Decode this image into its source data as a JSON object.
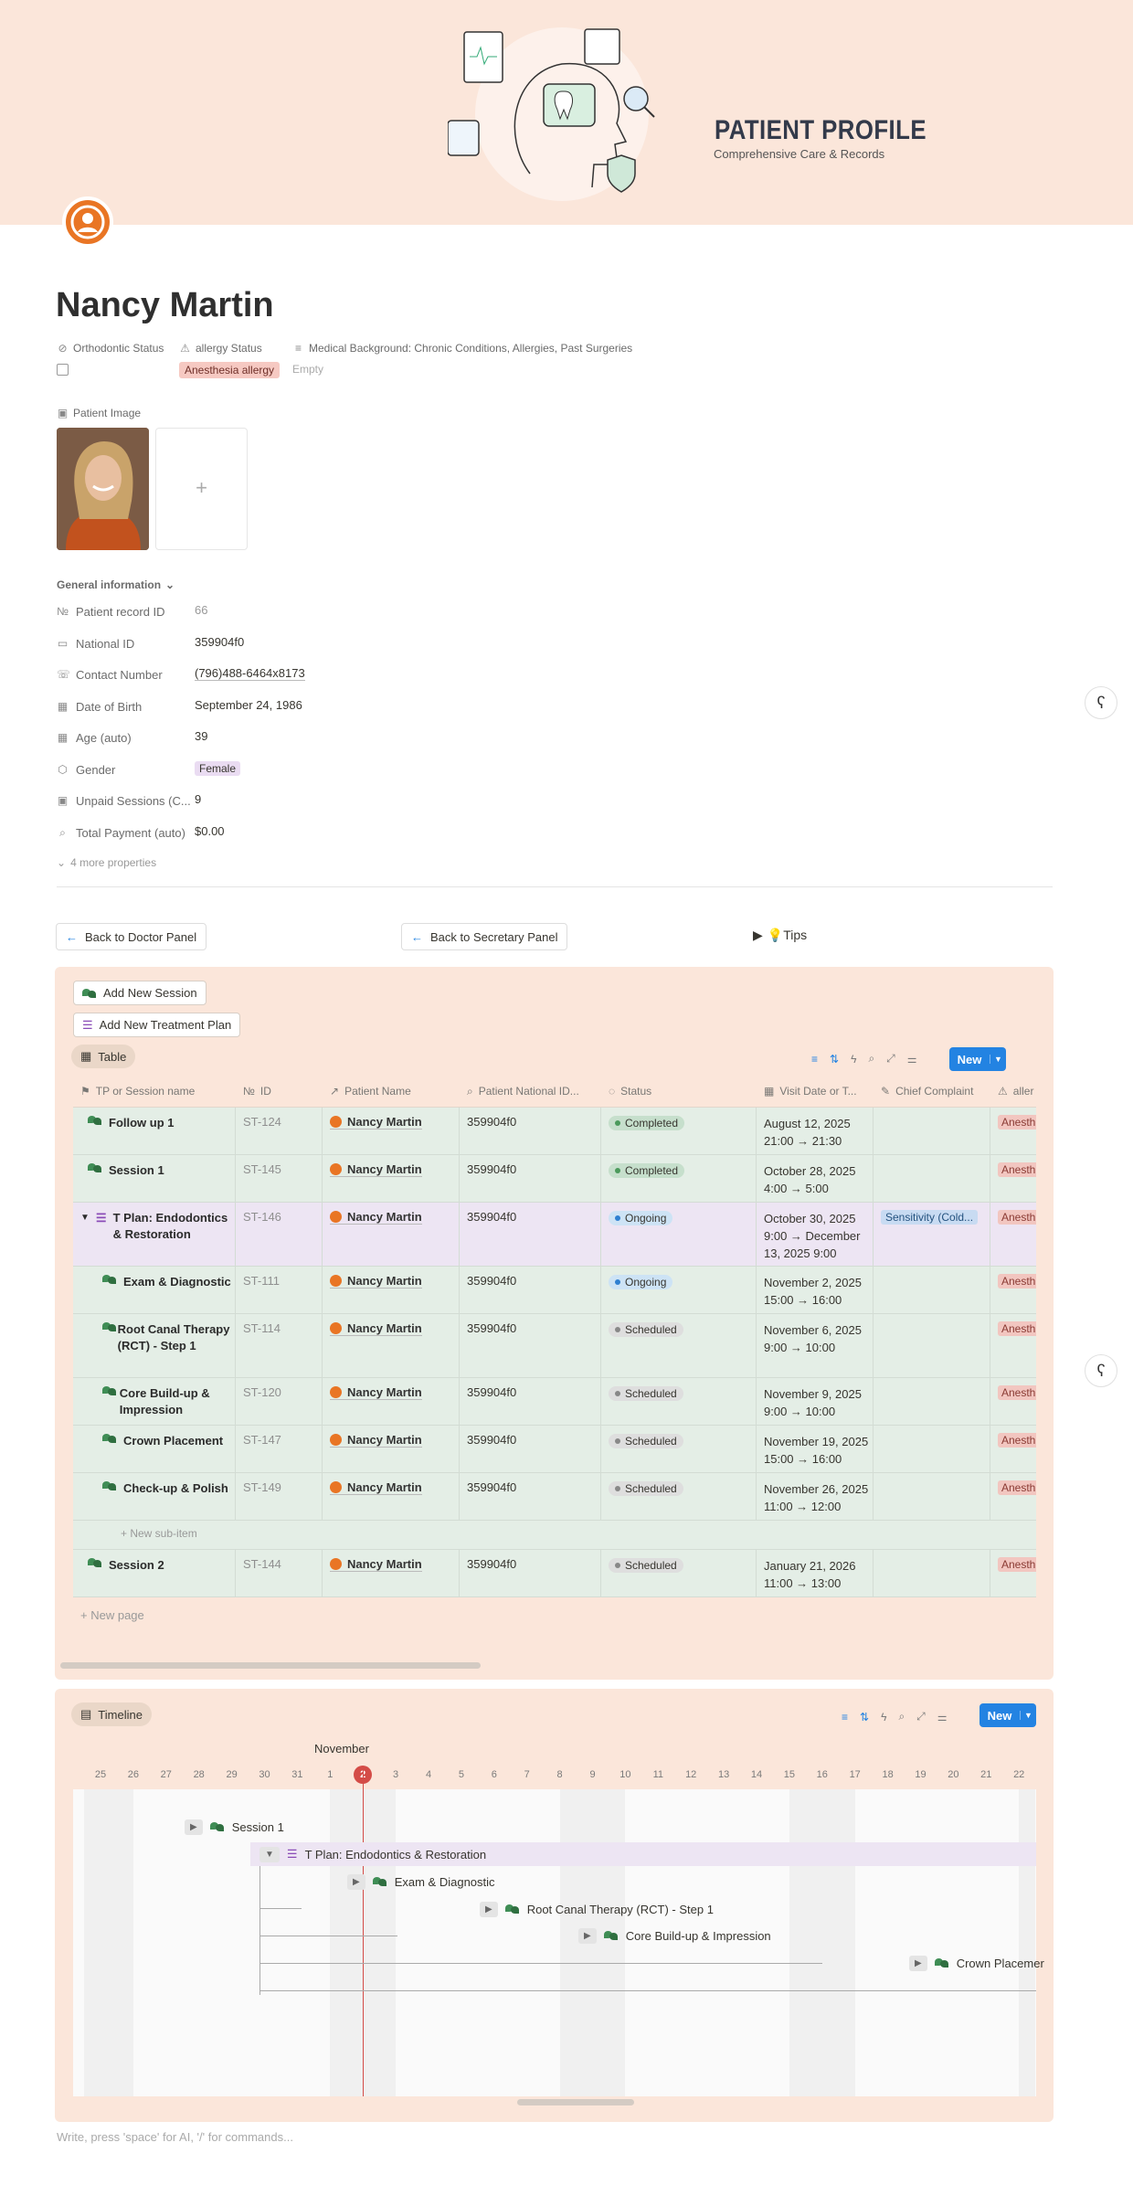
{
  "banner": {
    "title": "PATIENT PROFILE",
    "subtitle": "Comprehensive Care & Records"
  },
  "page_title": "Nancy Martin",
  "props": {
    "ortho_label": "Orthodontic Status",
    "allergy_label": "allergy Status",
    "allergy_value": "Anesthesia allergy",
    "medical_label": "Medical Background: Chronic Conditions, Allergies, Past Surgeries",
    "medical_value": "Empty"
  },
  "image_label": "Patient Image",
  "general_label": "General information",
  "fields": [
    {
      "label": "Patient record ID",
      "value": "66"
    },
    {
      "label": "National ID",
      "value": "359904f0"
    },
    {
      "label": "Contact Number",
      "value": "(796)488-6464x8173"
    },
    {
      "label": "Date of Birth",
      "value": "September 24, 1986"
    },
    {
      "label": "Age (auto)",
      "value": "39"
    },
    {
      "label": "Gender",
      "value": "Female"
    },
    {
      "label": "Unpaid Sessions (C...",
      "value": "9"
    },
    {
      "label": "Total Payment (auto)",
      "value": "$0.00"
    }
  ],
  "more_props": "4 more properties",
  "nav": {
    "doctor": "Back to Doctor Panel",
    "secretary": "Back to Secretary Panel",
    "tips": "💡Tips"
  },
  "panel": {
    "add_session": "Add New Session",
    "add_plan": "Add New Treatment Plan",
    "view_tab": "Table",
    "new": "New",
    "new_sub": "New sub-item",
    "new_page": "New page"
  },
  "columns": [
    "TP or Session name",
    "ID",
    "Patient Name",
    "Patient National ID...",
    "Status",
    "Visit Date or T...",
    "Chief Complaint",
    "aller"
  ],
  "rows": [
    {
      "name": "Follow up 1",
      "id": "ST-124",
      "patient": "Nancy Martin",
      "nid": "359904f0",
      "status": "Completed",
      "date": "August 12, 2025 21:00 → 21:30",
      "cc": "",
      "allergy": "Anesth"
    },
    {
      "name": "Session 1",
      "id": "ST-145",
      "patient": "Nancy Martin",
      "nid": "359904f0",
      "status": "Completed",
      "date": "October 28, 2025 4:00 → 5:00",
      "cc": "",
      "allergy": "Anesth"
    },
    {
      "name": "T Plan: Endodontics & Restoration",
      "id": "ST-146",
      "patient": "Nancy Martin",
      "nid": "359904f0",
      "status": "Ongoing",
      "date": "October 30, 2025 9:00 → December 13, 2025 9:00",
      "cc": "Sensitivity (Cold...",
      "allergy": "Anesth"
    },
    {
      "name": "Exam & Diagnostic",
      "id": "ST-111",
      "patient": "Nancy Martin",
      "nid": "359904f0",
      "status": "Ongoing",
      "date": "November 2, 2025 15:00 → 16:00",
      "cc": "",
      "allergy": "Anesth"
    },
    {
      "name": "Root Canal Therapy (RCT) - Step 1",
      "id": "ST-114",
      "patient": "Nancy Martin",
      "nid": "359904f0",
      "status": "Scheduled",
      "date": "November 6, 2025 9:00 → 10:00",
      "cc": "",
      "allergy": "Anesth"
    },
    {
      "name": "Core Build-up & Impression",
      "id": "ST-120",
      "patient": "Nancy Martin",
      "nid": "359904f0",
      "status": "Scheduled",
      "date": "November 9, 2025 9:00 → 10:00",
      "cc": "",
      "allergy": "Anesth"
    },
    {
      "name": "Crown Placement",
      "id": "ST-147",
      "patient": "Nancy Martin",
      "nid": "359904f0",
      "status": "Scheduled",
      "date": "November 19, 2025 15:00 → 16:00",
      "cc": "",
      "allergy": "Anesth"
    },
    {
      "name": "Check-up & Polish",
      "id": "ST-149",
      "patient": "Nancy Martin",
      "nid": "359904f0",
      "status": "Scheduled",
      "date": "November 26, 2025 11:00 → 12:00",
      "cc": "",
      "allergy": "Anesth"
    },
    {
      "name": "Session 2",
      "id": "ST-144",
      "patient": "Nancy Martin",
      "nid": "359904f0",
      "status": "Scheduled",
      "date": "January 21, 2026 11:00 → 13:00",
      "cc": "",
      "allergy": "Anesth"
    }
  ],
  "timeline": {
    "tab": "Timeline",
    "new": "New",
    "month": "November",
    "days": [
      "25",
      "26",
      "27",
      "28",
      "29",
      "30",
      "31",
      "1",
      "2",
      "3",
      "4",
      "5",
      "6",
      "7",
      "8",
      "9",
      "10",
      "11",
      "12",
      "13",
      "14",
      "15",
      "16",
      "17",
      "18",
      "19",
      "20",
      "21",
      "22"
    ],
    "today": "2",
    "items": [
      "Session 1",
      "T Plan: Endodontics & Restoration",
      "Exam & Diagnostic",
      "Root Canal Therapy (RCT) - Step 1",
      "Core Build-up & Impression",
      "Crown Placemer"
    ]
  },
  "footer_placeholder": "Write, press 'space' for AI, '/' for commands..."
}
